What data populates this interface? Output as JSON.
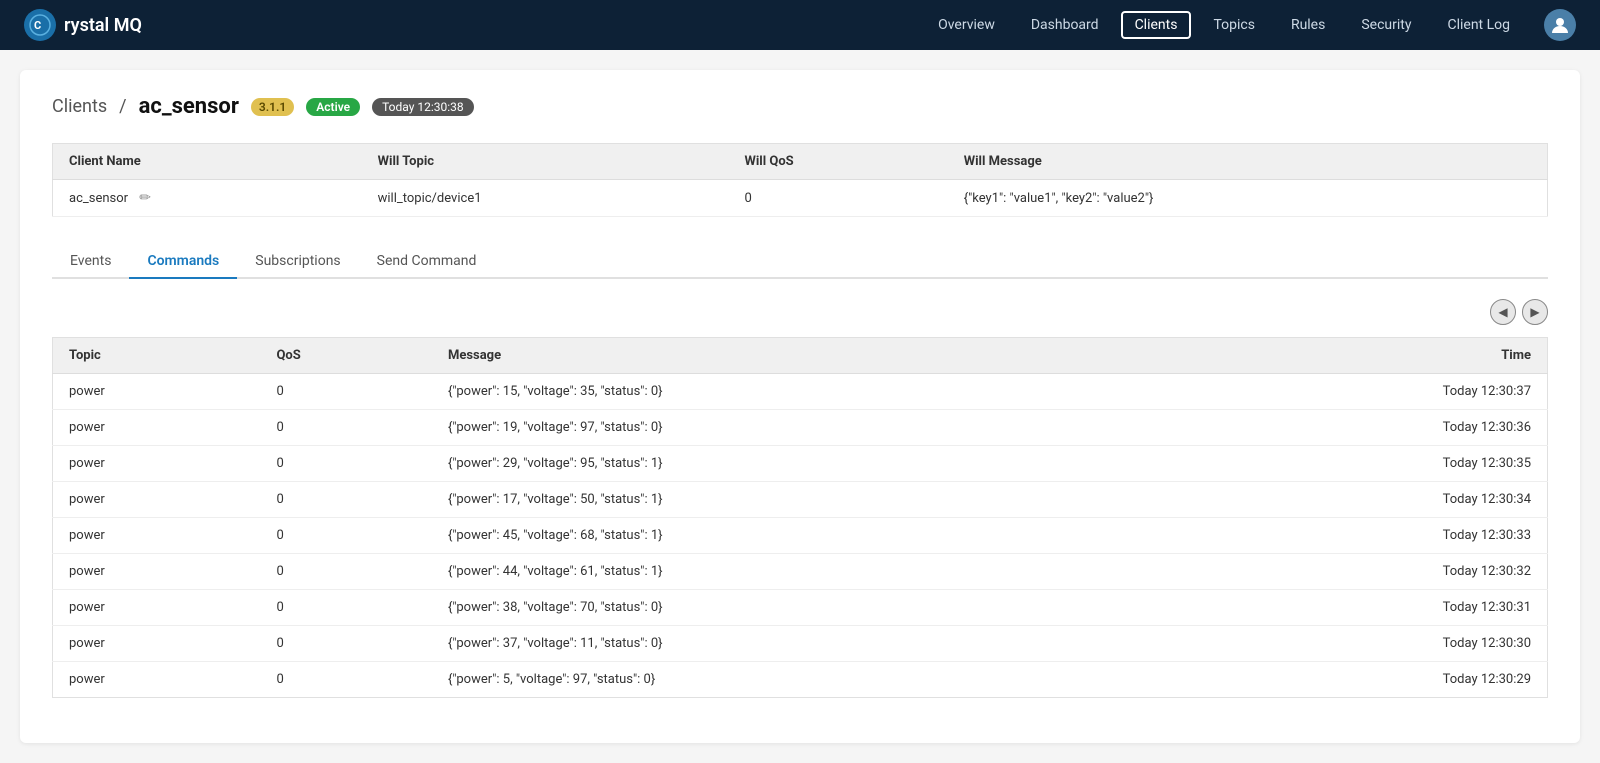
{
  "navbar": {
    "brand": "rystal MQ",
    "logo_char": "C",
    "links": [
      "Overview",
      "Dashboard",
      "Clients",
      "Topics",
      "Rules",
      "Security",
      "Client Log"
    ],
    "active_link": "Clients"
  },
  "breadcrumb": {
    "parent": "Clients",
    "separator": "/",
    "child": "ac_sensor"
  },
  "badges": {
    "version": "3.1.1",
    "status": "Active",
    "time": "Today 12:30:38"
  },
  "client_table": {
    "columns": [
      "Client Name",
      "Will Topic",
      "Will QoS",
      "Will Message"
    ],
    "row": {
      "name": "ac_sensor",
      "will_topic": "will_topic/device1",
      "will_qos": "0",
      "will_message": "{\"key1\": \"value1\", \"key2\": \"value2\"}"
    }
  },
  "tabs": [
    {
      "label": "Events",
      "active": false
    },
    {
      "label": "Commands",
      "active": true
    },
    {
      "label": "Subscriptions",
      "active": false
    },
    {
      "label": "Send Command",
      "active": false
    }
  ],
  "commands_table": {
    "columns": [
      "Topic",
      "QoS",
      "Message",
      "Time"
    ],
    "rows": [
      {
        "topic": "power",
        "qos": "0",
        "message": "{\"power\": 15, \"voltage\": 35, \"status\": 0}",
        "time": "Today 12:30:37"
      },
      {
        "topic": "power",
        "qos": "0",
        "message": "{\"power\": 19, \"voltage\": 97, \"status\": 0}",
        "time": "Today 12:30:36"
      },
      {
        "topic": "power",
        "qos": "0",
        "message": "{\"power\": 29, \"voltage\": 95, \"status\": 1}",
        "time": "Today 12:30:35"
      },
      {
        "topic": "power",
        "qos": "0",
        "message": "{\"power\": 17, \"voltage\": 50, \"status\": 1}",
        "time": "Today 12:30:34"
      },
      {
        "topic": "power",
        "qos": "0",
        "message": "{\"power\": 45, \"voltage\": 68, \"status\": 1}",
        "time": "Today 12:30:33"
      },
      {
        "topic": "power",
        "qos": "0",
        "message": "{\"power\": 44, \"voltage\": 61, \"status\": 1}",
        "time": "Today 12:30:32"
      },
      {
        "topic": "power",
        "qos": "0",
        "message": "{\"power\": 38, \"voltage\": 70, \"status\": 0}",
        "time": "Today 12:30:31"
      },
      {
        "topic": "power",
        "qos": "0",
        "message": "{\"power\": 37, \"voltage\": 11, \"status\": 0}",
        "time": "Today 12:30:30"
      },
      {
        "topic": "power",
        "qos": "0",
        "message": "{\"power\": 5, \"voltage\": 97, \"status\": 0}",
        "time": "Today 12:30:29"
      }
    ]
  },
  "icons": {
    "edit": "✏",
    "scroll_left": "◀",
    "scroll_right": "▶",
    "user": "👤"
  }
}
